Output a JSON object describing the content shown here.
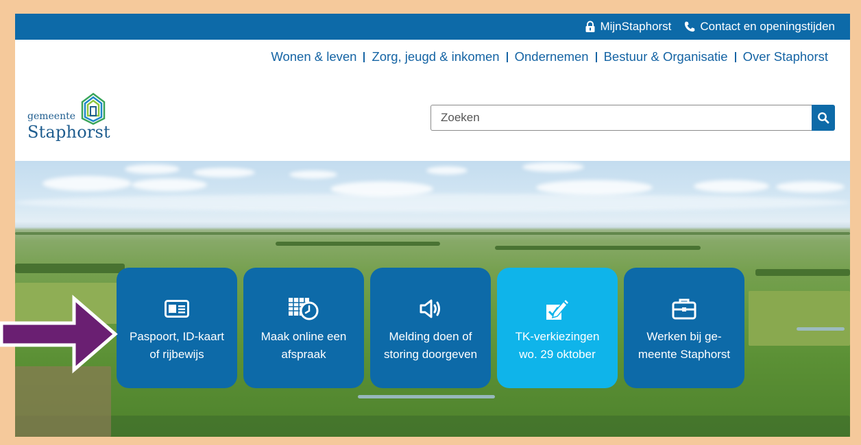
{
  "topbar": {
    "mijn_label": "MijnStaphorst",
    "contact_label": "Contact en openingstijden"
  },
  "nav": {
    "items": [
      "Wonen & leven",
      "Zorg, jeugd & inkomen",
      "Ondernemen",
      "Bestuur & Organisatie",
      "Over Staphorst"
    ]
  },
  "logo": {
    "small": "gemeente",
    "big": "Staphorst"
  },
  "search": {
    "placeholder": "Zoeken"
  },
  "tiles": [
    {
      "line1": "Paspoort, ID-kaart",
      "line2": "of rijbewijs",
      "icon": "id-card-icon"
    },
    {
      "line1": "Maak online een",
      "line2": "afspraak",
      "icon": "calendar-clock-icon"
    },
    {
      "line1": "Melding doen of",
      "line2": "storing doorgeven",
      "icon": "megaphone-icon"
    },
    {
      "line1": "TK-verkiezingen",
      "line2": "wo. 29 oktober",
      "icon": "ballot-pencil-icon"
    },
    {
      "line1": "Werken bij ge-",
      "line2": "meente Staphorst",
      "icon": "briefcase-icon"
    }
  ],
  "colors": {
    "brand_blue": "#0d6aa8",
    "accent_cyan": "#0fb4ea",
    "nav_blue": "#1564a4",
    "frame": "#f5c99b",
    "annotation_arrow": "#6a1f72"
  }
}
